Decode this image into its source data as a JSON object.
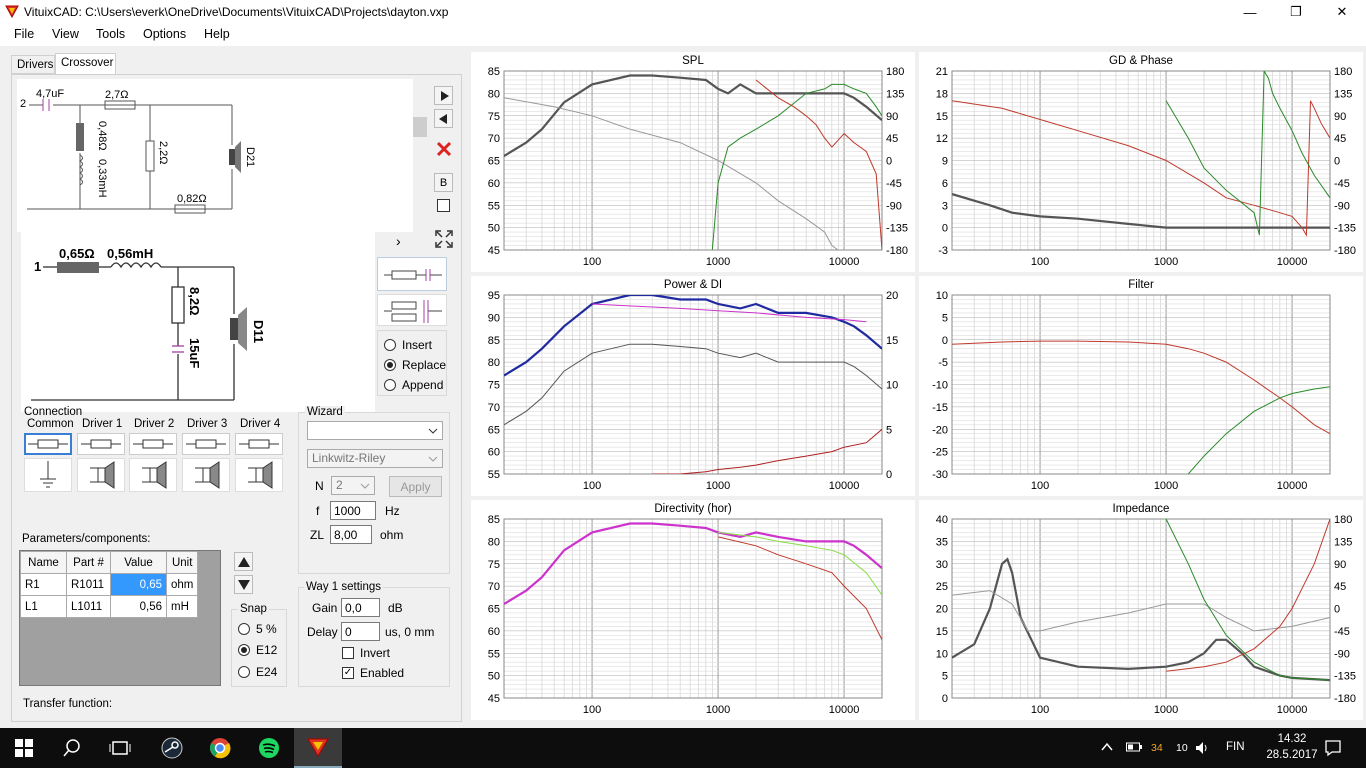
{
  "window": {
    "title": "VituixCAD: C:\\Users\\everk\\OneDrive\\Documents\\VituixCAD\\Projects\\dayton.vxp",
    "minimize": "—",
    "restore": "❐",
    "close": "✕"
  },
  "menu": [
    "File",
    "View",
    "Tools",
    "Options",
    "Help"
  ],
  "tabs": {
    "drivers": "Drivers",
    "crossover": "Crossover"
  },
  "circuit_top": {
    "node": "2",
    "c1": "4,7uF",
    "r1": "2,7Ω",
    "r_shunt": "0,48Ω",
    "l_shunt": "0,33mH",
    "r2": "2,2Ω",
    "r3": "0,82Ω",
    "driver": "D21"
  },
  "circuit_zoom": {
    "node": "1",
    "r1": "0,65Ω",
    "l1": "0,56mH",
    "r2": "8,2Ω",
    "c1": "15uF",
    "driver": "D11"
  },
  "tool_buttons": {
    "b": "B",
    "expand_arrow": "›"
  },
  "insert_mode": {
    "options": [
      "Insert",
      "Replace",
      "Append"
    ],
    "selected": "Replace"
  },
  "connection": {
    "label": "Connection",
    "items": [
      "Common",
      "Driver 1",
      "Driver 2",
      "Driver 3",
      "Driver 4"
    ]
  },
  "wizard": {
    "label": "Wizard",
    "type": "",
    "filter": "Linkwitz-Riley",
    "n_label": "N",
    "n_value": "2",
    "apply": "Apply",
    "f_label": "f",
    "f_value": "1000",
    "f_unit": "Hz",
    "zl_label": "ZL",
    "zl_value": "8,00",
    "zl_unit": "ohm"
  },
  "params": {
    "label": "Parameters/components:",
    "headers": [
      "Name",
      "Part #",
      "Value",
      "Unit"
    ],
    "rows": [
      {
        "name": "R1",
        "part": "R1011",
        "value": "0,65",
        "unit": "ohm"
      },
      {
        "name": "L1",
        "part": "L1011",
        "value": "0,56",
        "unit": "mH"
      }
    ]
  },
  "snap": {
    "label": "Snap",
    "options": [
      "5 %",
      "E12",
      "E24"
    ],
    "selected": "E12"
  },
  "way_settings": {
    "label": "Way 1 settings",
    "gain_label": "Gain",
    "gain_value": "0,0",
    "gain_unit": "dB",
    "delay_label": "Delay",
    "delay_value": "0",
    "delay_unit": "us, 0 mm",
    "invert": "Invert",
    "invert_checked": false,
    "enabled": "Enabled",
    "enabled_checked": true
  },
  "transfer_function": "Transfer function:",
  "chart_data": [
    {
      "type": "line",
      "title": "SPL",
      "xscale": "log",
      "xlim": [
        20,
        20000
      ],
      "xticks": [
        "100",
        "1000",
        "10000"
      ],
      "ylim": [
        45,
        85
      ],
      "yticks_left": [
        "85",
        "80",
        "75",
        "70",
        "65",
        "60",
        "55",
        "50",
        "45"
      ],
      "yticks_right": [
        "180",
        "135",
        "90",
        "45",
        "0",
        "-45",
        "-90",
        "-135",
        "-180"
      ],
      "series": [
        {
          "color": "#555555",
          "x": [
            20,
            30,
            40,
            60,
            100,
            200,
            300,
            500,
            800,
            1000,
            1200,
            1500,
            2000,
            3000,
            5000,
            8000,
            10000,
            12000,
            15000,
            20000
          ],
          "y": [
            66,
            69,
            72,
            78,
            82,
            84,
            84,
            83.5,
            83,
            81,
            80,
            82,
            80,
            80,
            80,
            80,
            80,
            79,
            77,
            74
          ]
        },
        {
          "color": "#999999",
          "x": [
            20,
            50,
            100,
            200,
            500,
            1000,
            2000,
            3000,
            5000,
            7000,
            8000,
            10000,
            15000
          ],
          "y": [
            79,
            77,
            75,
            72,
            69,
            65,
            60,
            56,
            52,
            49,
            46,
            44,
            42
          ]
        },
        {
          "color": "#2a8a2a",
          "x": [
            900,
            1000,
            1200,
            1500,
            2000,
            3000,
            5000,
            7000,
            8000,
            10000,
            12000,
            15000,
            18000,
            20000
          ],
          "y": [
            45,
            60,
            68,
            70,
            72,
            75,
            80,
            81,
            82,
            82,
            81,
            80,
            77,
            75
          ]
        },
        {
          "color": "#c0392b",
          "x": [
            2000,
            3000,
            4000,
            5000,
            6000,
            7000,
            8000,
            10000,
            12000,
            15000,
            18000,
            20000
          ],
          "y": [
            83,
            79,
            77,
            75,
            73,
            70,
            68,
            71,
            69,
            67,
            62,
            45
          ]
        }
      ]
    },
    {
      "type": "line",
      "title": "GD & Phase",
      "xscale": "log",
      "xlim": [
        20,
        20000
      ],
      "xticks": [
        "100",
        "1000",
        "10000"
      ],
      "ylim": [
        -3,
        21
      ],
      "yticks_left": [
        "21",
        "18",
        "15",
        "12",
        "9",
        "6",
        "3",
        "0",
        "-3"
      ],
      "yticks_right": [
        "180",
        "135",
        "90",
        "45",
        "0",
        "-45",
        "-90",
        "-135",
        "-180"
      ],
      "series": [
        {
          "color": "#555555",
          "x": [
            20,
            40,
            60,
            100,
            200,
            500,
            1000,
            2000,
            5000,
            10000,
            20000
          ],
          "y": [
            4.5,
            3,
            2,
            1.5,
            1.2,
            0.5,
            0,
            0,
            0,
            0,
            0
          ]
        },
        {
          "color": "#c0392b",
          "x": [
            20,
            50,
            100,
            200,
            500,
            1000,
            2000,
            3000,
            5000,
            8000,
            10000,
            12000,
            13000,
            14000,
            15000,
            17000,
            20000
          ],
          "y": [
            17,
            16,
            14.5,
            13,
            11,
            9,
            6,
            4,
            3,
            2,
            1.5,
            0,
            -1,
            17,
            16,
            14,
            12
          ]
        },
        {
          "color": "#2a8a2a",
          "x": [
            1000,
            1500,
            2000,
            3000,
            5000,
            5500,
            6000,
            6500,
            7000,
            8000,
            10000,
            12000,
            15000,
            20000
          ],
          "y": [
            17,
            12,
            8,
            5,
            2,
            -1,
            21,
            20,
            18,
            16,
            13,
            10,
            7,
            4
          ]
        }
      ]
    },
    {
      "type": "line",
      "title": "Power & DI",
      "xscale": "log",
      "xlim": [
        20,
        20000
      ],
      "xticks": [
        "100",
        "1000",
        "10000"
      ],
      "ylim": [
        55,
        95
      ],
      "yticks_left": [
        "95",
        "90",
        "85",
        "80",
        "75",
        "70",
        "65",
        "60",
        "55"
      ],
      "yticks_right": [
        "20",
        "15",
        "10",
        "5",
        "0"
      ],
      "series": [
        {
          "color": "#1f2aa0",
          "x": [
            20,
            30,
            40,
            60,
            100,
            200,
            300,
            500,
            800,
            1000,
            1500,
            2000,
            3000,
            5000,
            8000,
            10000,
            12000,
            15000,
            20000
          ],
          "y": [
            77,
            80,
            83,
            88,
            93,
            95,
            95,
            94,
            94,
            93,
            92,
            93,
            91,
            91,
            90,
            89,
            88,
            86,
            83
          ]
        },
        {
          "color": "#555555",
          "x": [
            20,
            30,
            40,
            60,
            100,
            200,
            300,
            500,
            800,
            1000,
            1500,
            2000,
            3000,
            5000,
            8000,
            10000,
            12000,
            15000,
            20000
          ],
          "y": [
            66,
            69,
            72,
            78,
            82,
            84,
            84,
            83.5,
            83,
            82,
            81,
            82,
            80,
            80,
            80,
            80,
            79,
            77,
            74
          ]
        },
        {
          "color": "#cc33cc",
          "x": [
            100,
            500,
            1000,
            2000,
            5000,
            10000,
            15000
          ],
          "y": [
            93,
            92,
            91.5,
            91,
            90,
            89.5,
            89
          ]
        },
        {
          "color": "#b02020",
          "x": [
            300,
            500,
            800,
            1000,
            1500,
            2000,
            3000,
            5000,
            8000,
            10000,
            15000,
            20000
          ],
          "y": [
            55,
            55,
            55.5,
            56,
            56.5,
            57,
            58,
            59,
            60,
            61,
            62,
            65
          ]
        }
      ]
    },
    {
      "type": "line",
      "title": "Filter",
      "xscale": "log",
      "xlim": [
        20,
        20000
      ],
      "xticks": [
        "100",
        "1000",
        "10000"
      ],
      "ylim": [
        -30,
        10
      ],
      "yticks_left": [
        "10",
        "5",
        "0",
        "-5",
        "-10",
        "-15",
        "-20",
        "-25",
        "-30"
      ],
      "series": [
        {
          "color": "#c0392b",
          "x": [
            20,
            50,
            100,
            200,
            500,
            1000,
            1500,
            2000,
            3000,
            5000,
            8000,
            10000,
            15000,
            20000
          ],
          "y": [
            -1,
            -0.5,
            -0.3,
            -0.3,
            -0.5,
            -1,
            -2,
            -3,
            -5,
            -9,
            -13,
            -15,
            -19,
            -21
          ]
        },
        {
          "color": "#2a8a2a",
          "x": [
            1500,
            2000,
            3000,
            5000,
            8000,
            10000,
            15000,
            20000
          ],
          "y": [
            -30,
            -26,
            -21,
            -16,
            -13,
            -12,
            -11,
            -10.5
          ]
        }
      ]
    },
    {
      "type": "line",
      "title": "Directivity (hor)",
      "xscale": "log",
      "xlim": [
        20,
        20000
      ],
      "xticks": [
        "100",
        "1000",
        "10000"
      ],
      "ylim": [
        45,
        85
      ],
      "yticks_left": [
        "85",
        "80",
        "75",
        "70",
        "65",
        "60",
        "55",
        "50",
        "45"
      ],
      "series": [
        {
          "color": "#cc33cc",
          "x": [
            20,
            30,
            40,
            60,
            100,
            200,
            300,
            500,
            800,
            1000,
            1500,
            2000,
            3000,
            5000,
            8000,
            10000,
            12000,
            15000,
            20000
          ],
          "y": [
            66,
            69,
            72,
            78,
            82,
            84,
            84,
            83.5,
            83,
            82,
            81,
            82,
            81,
            80,
            80,
            80,
            79,
            77,
            74
          ]
        },
        {
          "color": "#88dd44",
          "x": [
            1000,
            2000,
            3000,
            5000,
            8000,
            10000,
            15000,
            20000
          ],
          "y": [
            82,
            81,
            80,
            79,
            78,
            77,
            73,
            68
          ]
        },
        {
          "color": "#c0392b",
          "x": [
            1000,
            2000,
            3000,
            5000,
            8000,
            10000,
            15000,
            20000
          ],
          "y": [
            81,
            79,
            77,
            75,
            73,
            70,
            65,
            58
          ]
        }
      ]
    },
    {
      "type": "line",
      "title": "Impedance",
      "xscale": "log",
      "xlim": [
        20,
        20000
      ],
      "xticks": [
        "100",
        "1000",
        "10000"
      ],
      "ylim": [
        0,
        40
      ],
      "yticks_left": [
        "40",
        "35",
        "30",
        "25",
        "20",
        "15",
        "10",
        "5",
        "0"
      ],
      "yticks_right": [
        "180",
        "135",
        "90",
        "45",
        "0",
        "-45",
        "-90",
        "-135",
        "-180"
      ],
      "series": [
        {
          "color": "#555555",
          "x": [
            20,
            30,
            40,
            50,
            55,
            60,
            70,
            100,
            200,
            500,
            1000,
            1500,
            2000,
            2500,
            3000,
            4000,
            5000,
            8000,
            10000,
            20000
          ],
          "y": [
            9,
            12,
            20,
            30,
            31,
            28,
            18,
            9,
            7,
            6.5,
            7,
            8,
            10,
            13,
            13,
            10,
            7,
            5,
            4.5,
            4
          ]
        },
        {
          "color": "#999999",
          "x": [
            20,
            40,
            60,
            80,
            100,
            200,
            500,
            1000,
            2000,
            3000,
            5000,
            10000,
            20000
          ],
          "y": [
            23,
            24,
            21,
            15,
            15,
            17,
            19,
            21,
            21,
            18,
            15,
            16,
            18
          ]
        },
        {
          "color": "#c0392b",
          "x": [
            1000,
            2000,
            3000,
            5000,
            8000,
            10000,
            15000,
            20000
          ],
          "y": [
            6,
            7,
            8,
            11,
            16,
            20,
            30,
            40
          ]
        },
        {
          "color": "#2a8a2a",
          "x": [
            1000,
            1500,
            2000,
            3000,
            5000,
            8000,
            10000,
            20000
          ],
          "y": [
            40,
            30,
            22,
            14,
            8,
            5,
            4.5,
            4
          ]
        }
      ]
    }
  ],
  "taskbar": {
    "time": "14.32",
    "date": "28.5.2017",
    "lang": "FIN",
    "battery": "34",
    "vol": "10"
  }
}
